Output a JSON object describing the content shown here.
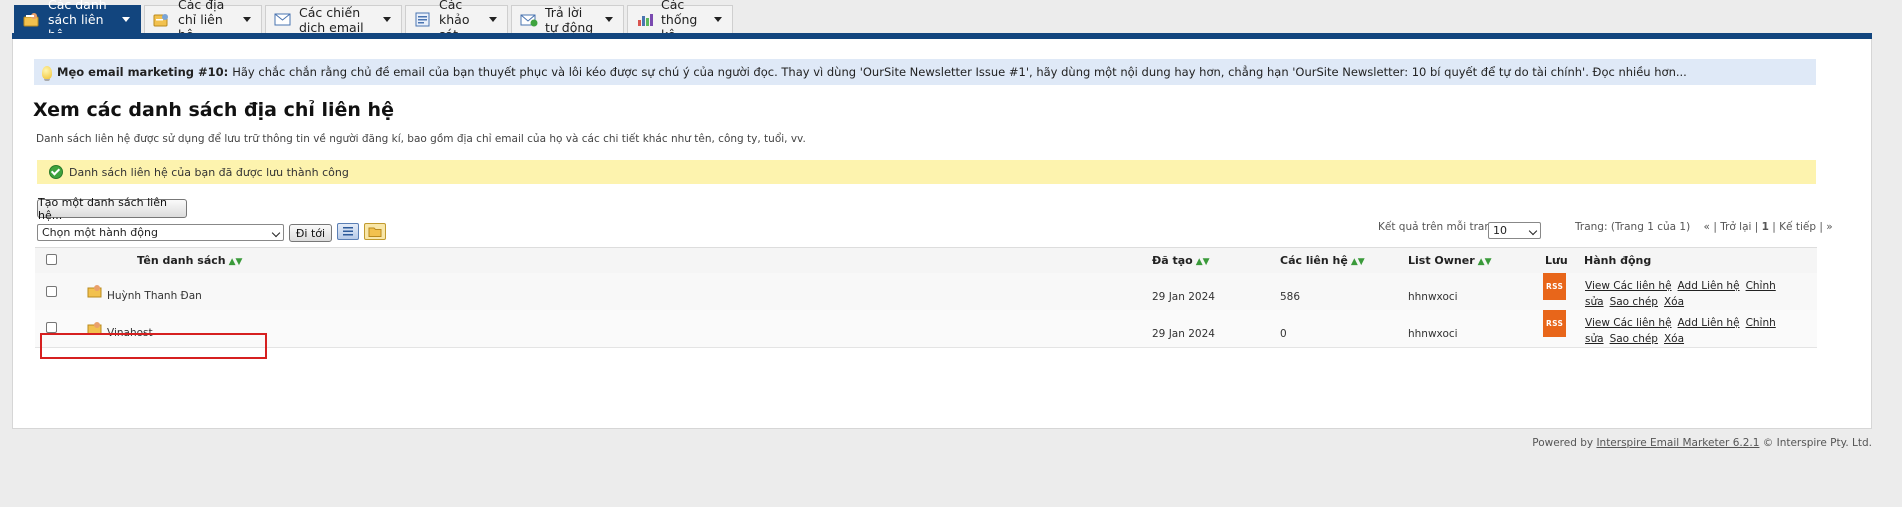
{
  "tabs": [
    {
      "label": "Các danh sách liên hệ",
      "icon": "contact-lists-icon",
      "active": true
    },
    {
      "label": "Các địa chỉ liên hệ",
      "icon": "contacts-icon",
      "active": false
    },
    {
      "label": "Các chiến dịch email",
      "icon": "email-campaigns-icon",
      "active": false
    },
    {
      "label": "Các khảo sát",
      "icon": "surveys-icon",
      "active": false
    },
    {
      "label": "Trả lời tự động",
      "icon": "autoresponders-icon",
      "active": false
    },
    {
      "label": "Các thống kê",
      "icon": "statistics-icon",
      "active": false
    }
  ],
  "tip": {
    "title": "Mẹo email marketing #10:",
    "text": "Hãy chắc chắn rằng chủ đề email của bạn thuyết phục và lôi kéo được sự chú ý của người đọc. Thay vì dùng 'OurSite Newsletter Issue #1', hãy dùng một nội dung hay hơn, chẳng hạn 'OurSite Newsletter: 10 bí quyết để tự do tài chính'. Đọc nhiều hơn..."
  },
  "page": {
    "title": "Xem các danh sách địa chỉ liên hệ",
    "description": "Danh sách liên hệ được sử dụng để lưu trữ thông tin về người đăng kí, bao gồm địa chỉ email của họ và các chi tiết khác như tên, công ty, tuổi, vv.",
    "success_message": "Danh sách liên hệ của bạn đã được lưu thành công"
  },
  "toolbar": {
    "create_label": "Tạo một danh sách liên hệ...",
    "action_select": "Chọn một hành động",
    "go_label": "Đi tới",
    "per_page_label": "Kết quả trên mỗi trang:",
    "per_page_value": "10",
    "pager": {
      "status": "Trang: (Trang 1 của 1)",
      "first": "«",
      "prev": "Trở lại",
      "current": "1",
      "next": "Kế tiếp",
      "last": "»"
    }
  },
  "table": {
    "headers": {
      "name": "Tên danh sách",
      "created": "Đã tạo",
      "contacts": "Các liên hệ",
      "owner": "List Owner",
      "archive": "Lưu",
      "actions": "Hành động"
    },
    "rows": [
      {
        "name": "Huỳnh Thanh Đan",
        "created": "29 Jan 2024",
        "contacts": "586",
        "owner": "hhnwxoci",
        "rss": "RSS"
      },
      {
        "name": "Vinahost",
        "created": "29 Jan 2024",
        "contacts": "0",
        "owner": "hhnwxoci",
        "rss": "RSS"
      }
    ],
    "row_actions": {
      "view": "View Các liên hệ",
      "add": "Add Liên hệ",
      "edit": "Chỉnh sửa",
      "copy": "Sao chép",
      "delete": "Xóa"
    }
  },
  "footer": {
    "prefix": "Powered by",
    "product": "Interspire Email Marketer 6.2.1",
    "suffix": "© Interspire Pty. Ltd."
  },
  "colors": {
    "nav_blue": "#12457e",
    "tip_bg": "#dfe9f7",
    "success_bg": "#fdf3ae",
    "rss_orange": "#e8661a",
    "highlight_red": "#d62020"
  }
}
